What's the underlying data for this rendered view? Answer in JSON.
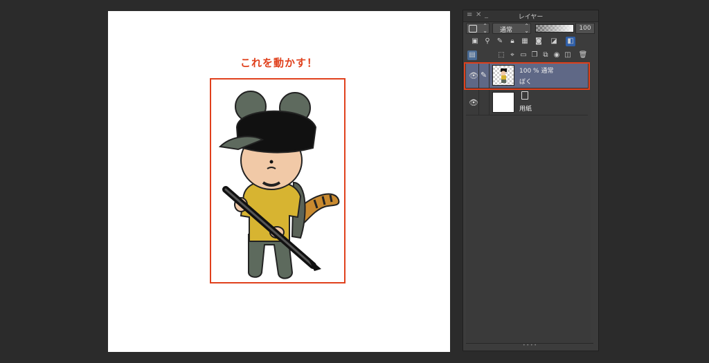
{
  "canvas": {
    "annotation": "これを動かす！"
  },
  "colors": {
    "accent": "#e0401c",
    "selected_layer": "#5f6886"
  },
  "layer_panel": {
    "title": "レイヤー",
    "blend_mode": "通常",
    "opacity": "100",
    "icons_row1": [
      "layer-property-icon",
      "reference-layer-icon",
      "draft-layer-icon",
      "lock-icon",
      "lock-transparent-icon",
      "mask-icon",
      "ruler-icon",
      "layer-color-icon"
    ],
    "icons_row2": [
      "layer-mode-icon",
      "new-raster-layer-icon",
      "new-vector-layer-icon",
      "new-folder-icon",
      "duplicate-icon",
      "merge-icon",
      "create-mask-icon",
      "apply-mask-icon",
      "delete-icon"
    ],
    "layers": [
      {
        "info": "100 % 通常",
        "name": "ぼく",
        "selected": true
      },
      {
        "info": "",
        "name": "用紙",
        "selected": false
      }
    ]
  }
}
